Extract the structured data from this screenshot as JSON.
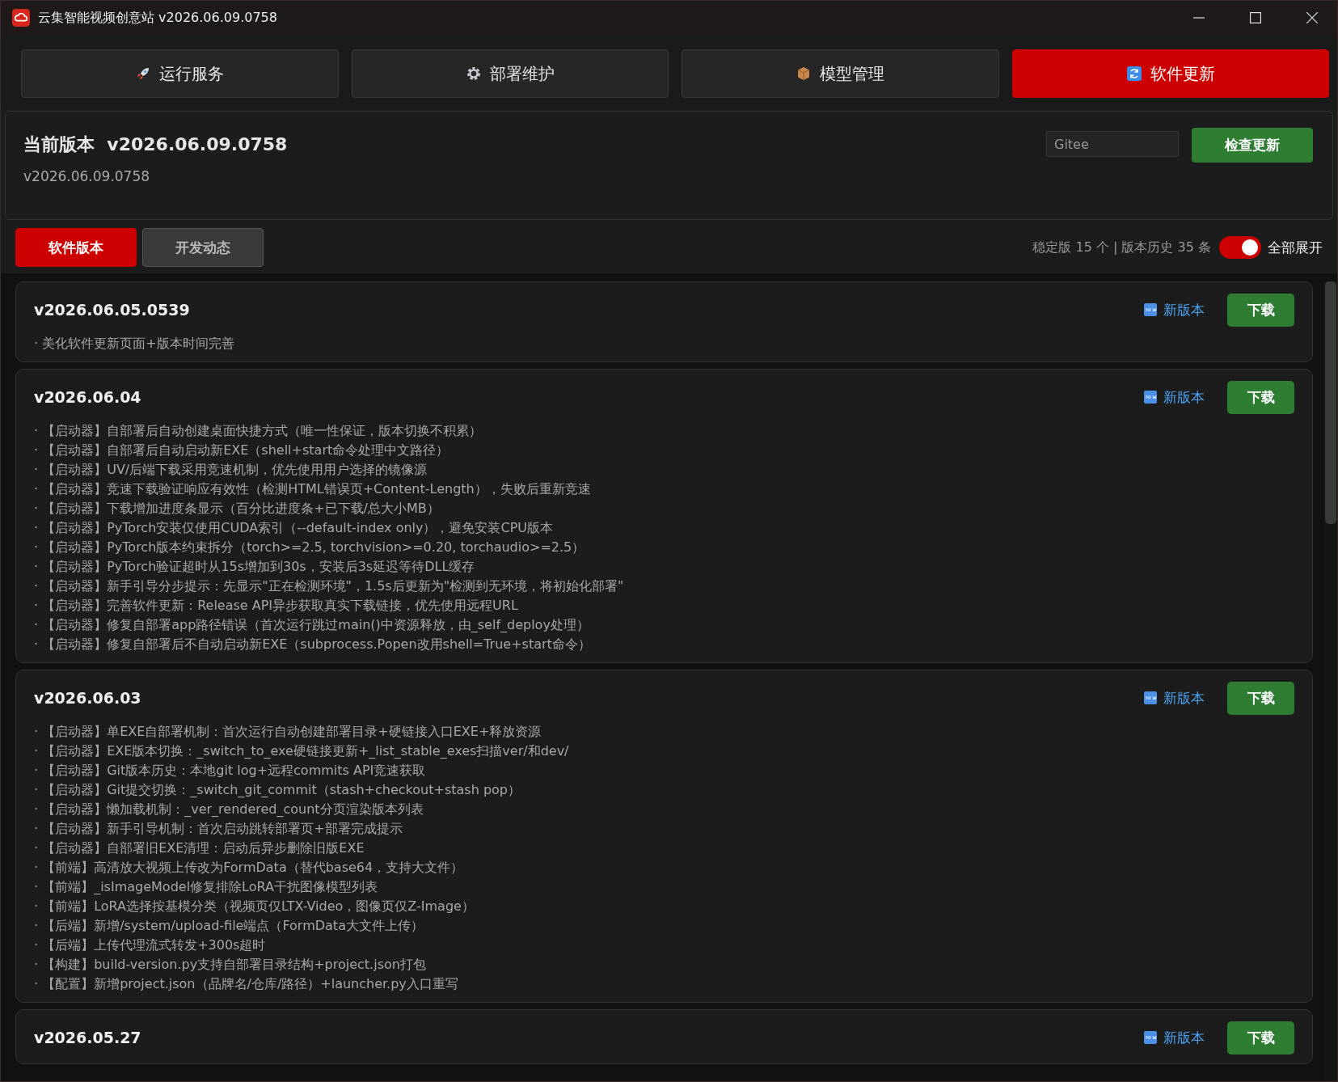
{
  "window": {
    "title": "云集智能视频创意站 v2026.06.09.0758"
  },
  "tabs": [
    {
      "label": "运行服务",
      "selected": false
    },
    {
      "label": "部署维护",
      "selected": false
    },
    {
      "label": "模型管理",
      "selected": false
    },
    {
      "label": "软件更新",
      "selected": true
    }
  ],
  "current": {
    "heading": "当前版本",
    "version": "v2026.06.09.0758",
    "subtitle": "v2026.06.09.0758",
    "source": "Gitee",
    "check_button": "检查更新"
  },
  "subtabs": [
    {
      "label": "软件版本",
      "selected": true
    },
    {
      "label": "开发动态",
      "selected": false
    }
  ],
  "summary": "稳定版 15 个 | 版本历史 35 条",
  "expand_all": {
    "label": "全部展开",
    "on": true
  },
  "versions": [
    {
      "version": "v2026.06.05.0539",
      "badge": "新版本",
      "button": "下载",
      "items": [
        "· 美化软件更新页面+版本时间完善"
      ]
    },
    {
      "version": "v2026.06.04",
      "badge": "新版本",
      "button": "下载",
      "items": [
        "· 【启动器】自部署后自动创建桌面快捷方式（唯一性保证，版本切换不积累）",
        "· 【启动器】自部署后自动启动新EXE（shell+start命令处理中文路径）",
        "· 【启动器】UV/后端下载采用竞速机制，优先使用用户选择的镜像源",
        "· 【启动器】竞速下载验证响应有效性（检测HTML错误页+Content-Length），失败后重新竞速",
        "· 【启动器】下载增加进度条显示（百分比进度条+已下载/总大小MB）",
        "· 【启动器】PyTorch安装仅使用CUDA索引（--default-index only），避免安装CPU版本",
        "· 【启动器】PyTorch版本约束拆分（torch>=2.5, torchvision>=0.20, torchaudio>=2.5）",
        "· 【启动器】PyTorch验证超时从15s增加到30s，安装后3s延迟等待DLL缓存",
        "· 【启动器】新手引导分步提示：先显示\"正在检测环境\"，1.5s后更新为\"检测到无环境，将初始化部署\"",
        "· 【启动器】完善软件更新：Release API异步获取真实下载链接，优先使用远程URL",
        "· 【启动器】修复自部署app路径错误（首次运行跳过main()中资源释放，由_self_deploy处理）",
        "· 【启动器】修复自部署后不自动启动新EXE（subprocess.Popen改用shell=True+start命令）"
      ]
    },
    {
      "version": "v2026.06.03",
      "badge": "新版本",
      "button": "下载",
      "items": [
        "· 【启动器】单EXE自部署机制：首次运行自动创建部署目录+硬链接入口EXE+释放资源",
        "· 【启动器】EXE版本切换：_switch_to_exe硬链接更新+_list_stable_exes扫描ver/和dev/",
        "· 【启动器】Git版本历史：本地git log+远程commits API竞速获取",
        "· 【启动器】Git提交切换：_switch_git_commit（stash+checkout+stash pop）",
        "· 【启动器】懒加载机制：_ver_rendered_count分页渲染版本列表",
        "· 【启动器】新手引导机制：首次启动跳转部署页+部署完成提示",
        "· 【启动器】自部署旧EXE清理：启动后异步删除旧版EXE",
        "· 【前端】高清放大视频上传改为FormData（替代base64，支持大文件）",
        "· 【前端】_isImageModel修复排除LoRA干扰图像模型列表",
        "· 【前端】LoRA选择按基模分类（视频页仅LTX-Video，图像页仅Z-Image）",
        "· 【后端】新增/system/upload-file端点（FormData大文件上传）",
        "· 【后端】上传代理流式转发+300s超时",
        "· 【构建】build-version.py支持自部署目录结构+project.json打包",
        "· 【配置】新增project.json（品牌名/仓库/路径）+launcher.py入口重写"
      ]
    },
    {
      "version": "v2026.05.27",
      "badge": "新版本",
      "button": "下载"
    }
  ]
}
